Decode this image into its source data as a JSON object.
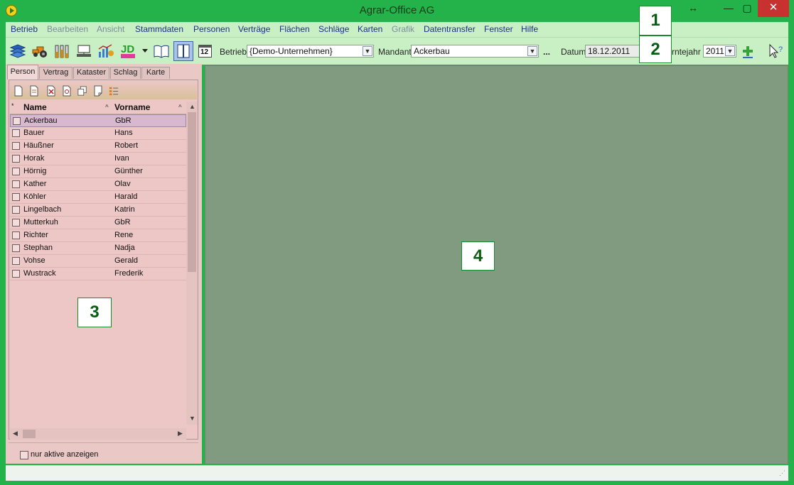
{
  "window": {
    "title": "Agrar-Office AG",
    "resize_glyph": "↔",
    "minimize_glyph": "—",
    "maximize_glyph": "▢",
    "close_glyph": "✕"
  },
  "menu": [
    {
      "label": "Betrieb",
      "enabled": true
    },
    {
      "label": "Bearbeiten",
      "enabled": false
    },
    {
      "label": "Ansicht",
      "enabled": false
    },
    {
      "label": "Stammdaten",
      "enabled": true
    },
    {
      "label": "Personen",
      "enabled": true
    },
    {
      "label": "Verträge",
      "enabled": true
    },
    {
      "label": "Flächen",
      "enabled": true
    },
    {
      "label": "Schläge",
      "enabled": true
    },
    {
      "label": "Karten",
      "enabled": true
    },
    {
      "label": "Grafik",
      "enabled": false
    },
    {
      "label": "Datentransfer",
      "enabled": true
    },
    {
      "label": "Fenster",
      "enabled": true
    },
    {
      "label": "Hilfe",
      "enabled": true
    }
  ],
  "toolbar": {
    "betrieb_label": "Betrieb",
    "betrieb_value": "{Demo-Unternehmen}",
    "mandant_label": "Mandant",
    "mandant_value": "Ackerbau",
    "more_glyph": "...",
    "datum_label": "Datum",
    "datum_value": "18.12.2011",
    "erntejahr_label": "rntejahr",
    "erntejahr_value": "2011",
    "calendar_day": "12",
    "jd_text": "JD"
  },
  "callouts": {
    "one": "1",
    "two": "2",
    "three": "3",
    "four": "4"
  },
  "left_panel": {
    "tabs": [
      "Person",
      "Vertrag",
      "Kataster",
      "Schlag",
      "Karte"
    ],
    "active_tab": "Person",
    "columns": {
      "star": "*",
      "name": "Name",
      "vorname": "Vorname"
    },
    "rows": [
      {
        "name": "Ackerbau",
        "vorname": "GbR",
        "selected": true
      },
      {
        "name": "Bauer",
        "vorname": "Hans",
        "selected": false
      },
      {
        "name": "Häußner",
        "vorname": "Robert",
        "selected": false
      },
      {
        "name": "Horak",
        "vorname": "Ivan",
        "selected": false
      },
      {
        "name": "Hörnig",
        "vorname": "Günther",
        "selected": false
      },
      {
        "name": "Kather",
        "vorname": "Olav",
        "selected": false
      },
      {
        "name": "Köhler",
        "vorname": "Harald",
        "selected": false
      },
      {
        "name": "Lingelbach",
        "vorname": "Katrin",
        "selected": false
      },
      {
        "name": "Mutterkuh",
        "vorname": "GbR",
        "selected": false
      },
      {
        "name": "Richter",
        "vorname": "Rene",
        "selected": false
      },
      {
        "name": "Stephan",
        "vorname": "Nadja",
        "selected": false
      },
      {
        "name": "Vohse",
        "vorname": "Gerald",
        "selected": false
      },
      {
        "name": "Wustrack",
        "vorname": "Frederik",
        "selected": false
      }
    ],
    "filter_label": "nur aktive anzeigen"
  },
  "colors": {
    "frame": "#23b34a",
    "menubar": "#c9f0c4",
    "panel": "#e9c8c6",
    "main": "#819b80"
  }
}
